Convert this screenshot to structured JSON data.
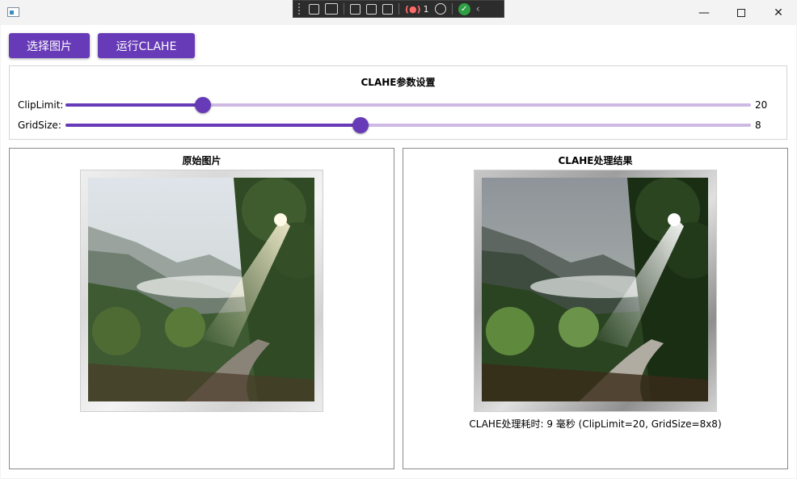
{
  "toolbar": {
    "select_label": "选择图片",
    "run_label": "运行CLAHE"
  },
  "debug_toolbar": {
    "error_count": "1"
  },
  "params": {
    "title": "CLAHE参数设置",
    "clip_limit": {
      "label": "ClipLimit:",
      "value": "20",
      "fraction": 0.2
    },
    "grid_size": {
      "label": "GridSize:",
      "value": "8",
      "fraction": 0.43
    }
  },
  "original": {
    "title": "原始图片"
  },
  "result": {
    "title": "CLAHE处理结果",
    "status": "CLAHE处理耗时: 9 毫秒 (ClipLimit=20, GridSize=8x8)"
  },
  "colors": {
    "accent": "#673ab7",
    "track": "#cdb9e3"
  }
}
